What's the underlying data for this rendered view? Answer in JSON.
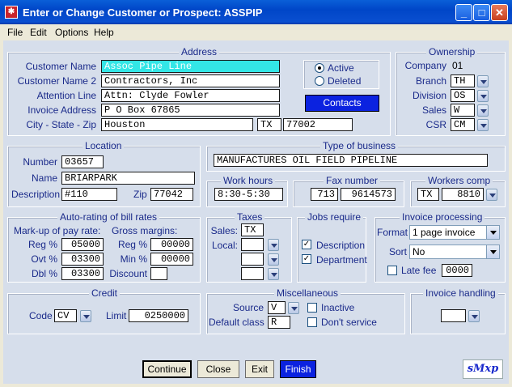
{
  "window": {
    "title": "Enter or Change Customer or Prospect:  ASSPIP",
    "app_icon": "app-icon"
  },
  "menu": [
    "File",
    "Edit",
    "Options",
    "Help"
  ],
  "address": {
    "title": "Address",
    "customer_name_label": "Customer Name",
    "customer_name": "Assoc Pipe Line",
    "customer_name2_label": "Customer Name 2",
    "customer_name2": "Contractors, Inc",
    "attention_label": "Attention Line",
    "attention": "Attn: Clyde Fowler",
    "invoice_address_label": "Invoice Address",
    "invoice_address": "P O Box 67865",
    "csz_label": "City - State - Zip",
    "city": "Houston",
    "state": "TX",
    "zip": "77002",
    "active_label": "Active",
    "deleted_label": "Deleted",
    "contacts_button": "Contacts"
  },
  "ownership": {
    "title": "Ownership",
    "company_label": "Company",
    "company": "01",
    "branch_label": "Branch",
    "branch": "TH",
    "division_label": "Division",
    "division": "OS",
    "sales_label": "Sales",
    "sales": "W",
    "csr_label": "CSR",
    "csr": "CM"
  },
  "location": {
    "title": "Location",
    "number_label": "Number",
    "number": "03657",
    "name_label": "Name",
    "name": "BRIARPARK",
    "description_label": "Description",
    "description": "#110",
    "zip_label": "Zip",
    "zip": "77042"
  },
  "business": {
    "title": "Type of business",
    "value": "MANUFACTURES OIL FIELD PIPELINE"
  },
  "work_hours": {
    "title": "Work hours",
    "value": "8:30-5:30"
  },
  "fax": {
    "title": "Fax number",
    "area": "713",
    "number": "9614573"
  },
  "workers_comp": {
    "title": "Workers comp",
    "state": "TX",
    "code": "8810"
  },
  "autorating": {
    "title": "Auto-rating of bill rates",
    "markup_label": "Mark-up of pay rate:",
    "margins_label": "Gross margins:",
    "reg_label": "Reg %",
    "reg": "05000",
    "ovt_label": "Ovt %",
    "ovt": "03300",
    "dbl_label": "Dbl %",
    "dbl": "03300",
    "gm_reg_label": "Reg %",
    "gm_reg": "00000",
    "gm_min_label": "Min %",
    "gm_min": "00000",
    "discount_label": "Discount",
    "discount": ""
  },
  "taxes": {
    "title": "Taxes",
    "sales_label": "Sales:",
    "sales": "TX",
    "local_label": "Local:"
  },
  "jobs": {
    "title": "Jobs require",
    "description_label": "Description",
    "department_label": "Department"
  },
  "invoice_processing": {
    "title": "Invoice processing",
    "format_label": "Format",
    "format": "1 page invoice",
    "sort_label": "Sort",
    "sort": "No",
    "late_fee_label": "Late fee",
    "late_fee": "0000"
  },
  "credit": {
    "title": "Credit",
    "code_label": "Code",
    "code": "CV",
    "limit_label": "Limit",
    "limit": "0250000"
  },
  "misc": {
    "title": "Miscellaneous",
    "source_label": "Source",
    "source": "V",
    "default_class_label": "Default class",
    "default_class": "R",
    "inactive_label": "Inactive",
    "dont_service_label": "Don't service"
  },
  "invoice_handling": {
    "title": "Invoice handling",
    "value": ""
  },
  "buttons": {
    "continue": "Continue",
    "close": "Close",
    "exit": "Exit",
    "finish": "Finish"
  },
  "logo": "sMxp",
  "colors": {
    "accent": "#0b22e0",
    "panel": "#D6DEEB",
    "highlight": "#33e6e6",
    "label": "#1a2a8a"
  }
}
